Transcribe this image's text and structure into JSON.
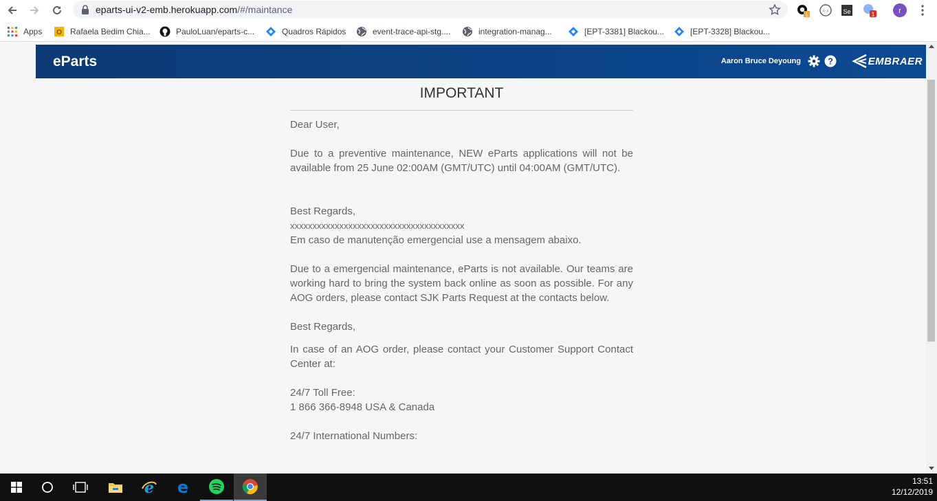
{
  "browser": {
    "url_host": "eparts-ui-v2-emb.herokuapp.com",
    "url_path": "/#/maintance",
    "bookmarks": [
      {
        "label": "Apps",
        "icon": "apps-grid-icon"
      },
      {
        "label": "Rafaela Bedim Chia...",
        "icon": "outlook-icon"
      },
      {
        "label": "PauloLuan/eparts-c...",
        "icon": "github-icon"
      },
      {
        "label": "Quadros Rápidos",
        "icon": "jira-icon"
      },
      {
        "label": "event-trace-api-stg....",
        "icon": "globe-icon"
      },
      {
        "label": "integration-manag...",
        "icon": "globe-icon"
      },
      {
        "label": "[EPT-3381] Blackou...",
        "icon": "jira-icon"
      },
      {
        "label": "[EPT-3328] Blackou...",
        "icon": "jira-icon"
      }
    ],
    "extension_badges": [
      "1",
      "Se",
      "1"
    ],
    "profile_initial": "r"
  },
  "header": {
    "brand": "eParts",
    "user_name": "Aaron Bruce Deyoung",
    "logo_text": "EMBRAER"
  },
  "notice": {
    "title": "IMPORTANT",
    "greeting": "Dear User,",
    "para1": "Due to a preventive maintenance, NEW eParts applications will not be available from 25 June 02:00AM (GMT/UTC) until 04:00AM (GMT/UTC).",
    "regards1": "Best Regards,",
    "placeholder": "xxxxxxxxxxxxxxxxxxxxxxxxxxxxxxxxxxxxxxx",
    "pt_note": "Em caso de manutenção emergencial use a mensagem abaixo.",
    "para2": "Due to a emergencial maintenance, eParts is not available. Our teams are working hard to bring the system back online as soon as possible. For any AOG orders, please contact SJK Parts Request at the contacts below.",
    "regards2": "Best Regards,",
    "para3": "In case of an AOG order, please contact your Customer Support Contact Center at:",
    "toll_free_label": "24/7 Toll Free:",
    "toll_free_number": "1 866 366-8948 USA & Canada",
    "intl_label": "24/7 International Numbers:"
  },
  "taskbar": {
    "time": "13:51",
    "date": "12/12/2019"
  }
}
